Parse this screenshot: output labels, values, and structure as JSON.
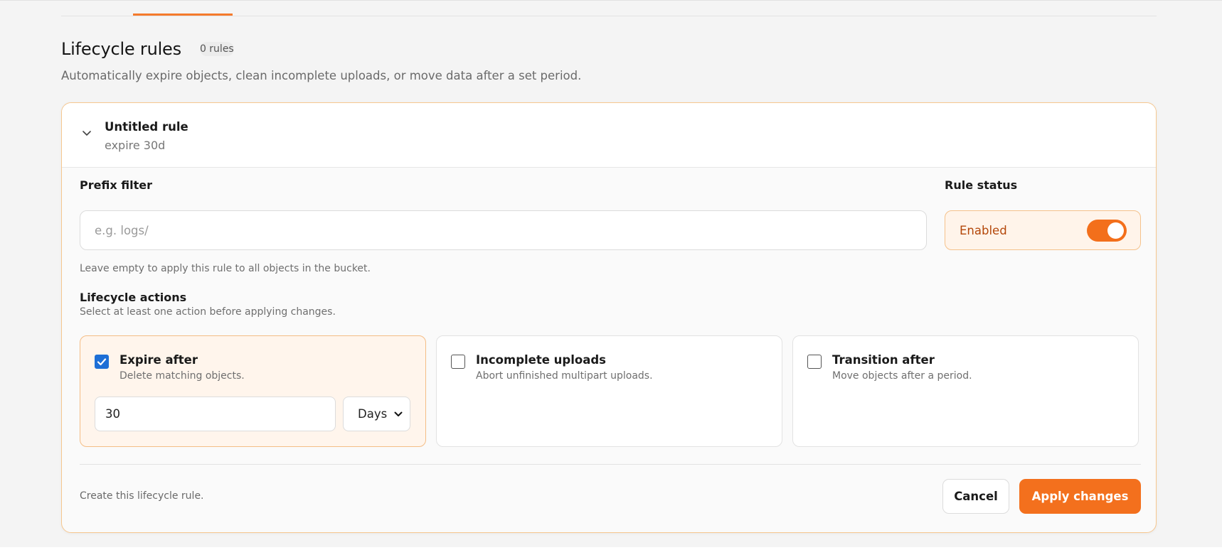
{
  "page": {
    "title": "Lifecycle rules",
    "rule_count": "0 rules",
    "subtitle": "Automatically expire objects, clean incomplete uploads, or move data after a set period."
  },
  "rule": {
    "name": "Untitled rule",
    "summary": "expire 30d",
    "prefix": {
      "label": "Prefix filter",
      "value": "",
      "placeholder": "e.g. logs/",
      "hint": "Leave empty to apply this rule to all objects in the bucket."
    },
    "status": {
      "label": "Rule status",
      "value": "Enabled",
      "enabled": true
    },
    "actions": {
      "label": "Lifecycle actions",
      "hint": "Select at least one action before applying changes.",
      "items": [
        {
          "title": "Expire after",
          "description": "Delete matching objects.",
          "checked": true,
          "amount": "30",
          "unit": "Days"
        },
        {
          "title": "Incomplete uploads",
          "description": "Abort unfinished multipart uploads.",
          "checked": false
        },
        {
          "title": "Transition after",
          "description": "Move objects after a period.",
          "checked": false
        }
      ]
    },
    "footer": {
      "note": "Create this lifecycle rule.",
      "cancel_label": "Cancel",
      "apply_label": "Apply changes"
    }
  },
  "colors": {
    "accent": "#f3701d",
    "accent_text": "#b4470a",
    "checkbox": "#1d6fd6"
  }
}
